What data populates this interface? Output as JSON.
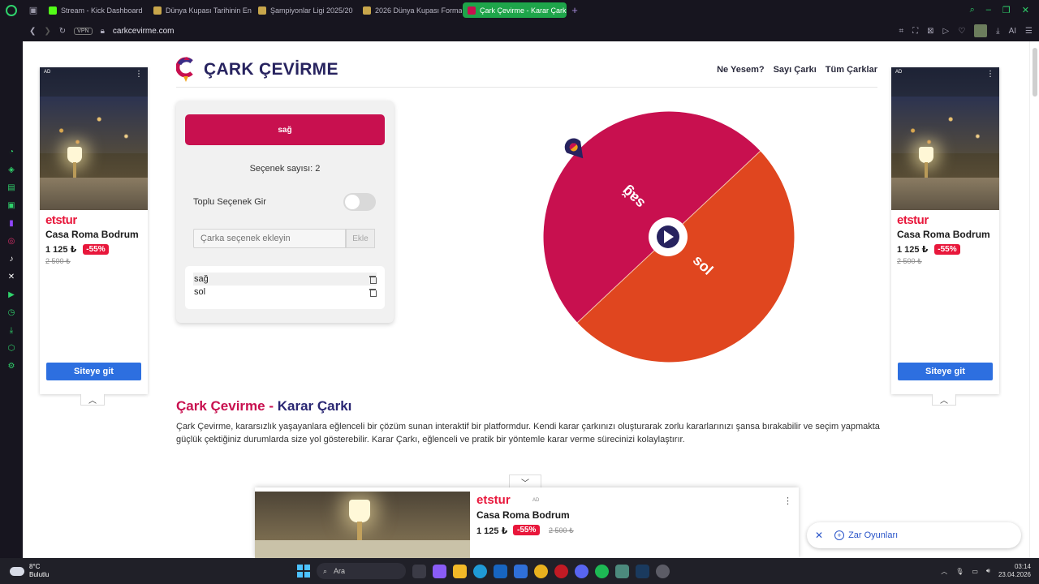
{
  "browser": {
    "tabs": [
      {
        "title": "Stream - Kick Dashboard",
        "color": "#53fc18"
      },
      {
        "title": "Dünya Kupası Tarihinin En",
        "color": "#c8a64b"
      },
      {
        "title": "Şampiyonlar Ligi 2025/20",
        "color": "#c8a64b"
      },
      {
        "title": "2026 Dünya Kupası Forma",
        "color": "#c8a64b"
      },
      {
        "title": "Çark Çevirme - Karar Çarkı",
        "color": "#c8104f",
        "active": true
      }
    ],
    "vpn": "VPN",
    "url": "carkcevirme.com",
    "ai_label": "AI"
  },
  "site": {
    "logo": "ÇARK ÇEVİRME",
    "nav": [
      "Ne Yesem?",
      "Sayı Çarkı",
      "Tüm Çarklar"
    ]
  },
  "panel": {
    "result": "sağ",
    "count_text": "Seçenek sayısı: 2",
    "bulk_label": "Toplu Seçenek Gir",
    "input_placeholder": "Çarka seçenek ekleyin",
    "add_button": "Ekle",
    "options": [
      "sağ",
      "sol"
    ]
  },
  "wheel": {
    "segments": [
      {
        "label": "sağ",
        "color": "#c8104f"
      },
      {
        "label": "sol",
        "color": "#e0461f"
      }
    ]
  },
  "ads": {
    "ad_label": "AD",
    "brand": "etstur",
    "title": "Casa Roma Bodrum",
    "price": "1 125 ₺",
    "discount": "-55%",
    "old_price": "2 500 ₺",
    "cta": "Siteye git"
  },
  "article": {
    "title_part1": "Çark Çevirme - ",
    "title_part2": "Karar Çarkı",
    "body": "Çark Çevirme, kararsızlık yaşayanlara eğlenceli bir çözüm sunan interaktif bir platformdur. Kendi karar çarkınızı oluşturarak zorlu kararlarınızı şansa bırakabilir ve seçim yapmakta güçlük çektiğiniz durumlarda size yol gösterebilir. Karar Çarkı, eğlenceli ve pratik bir yöntemle karar verme sürecinizi kolaylaştırır."
  },
  "dice": {
    "label": "Zar Oyunları"
  },
  "taskbar": {
    "temp": "8°C",
    "weather": "Bulutlu",
    "search": "Ara",
    "time": "03:14",
    "date": "23.04.2026"
  }
}
